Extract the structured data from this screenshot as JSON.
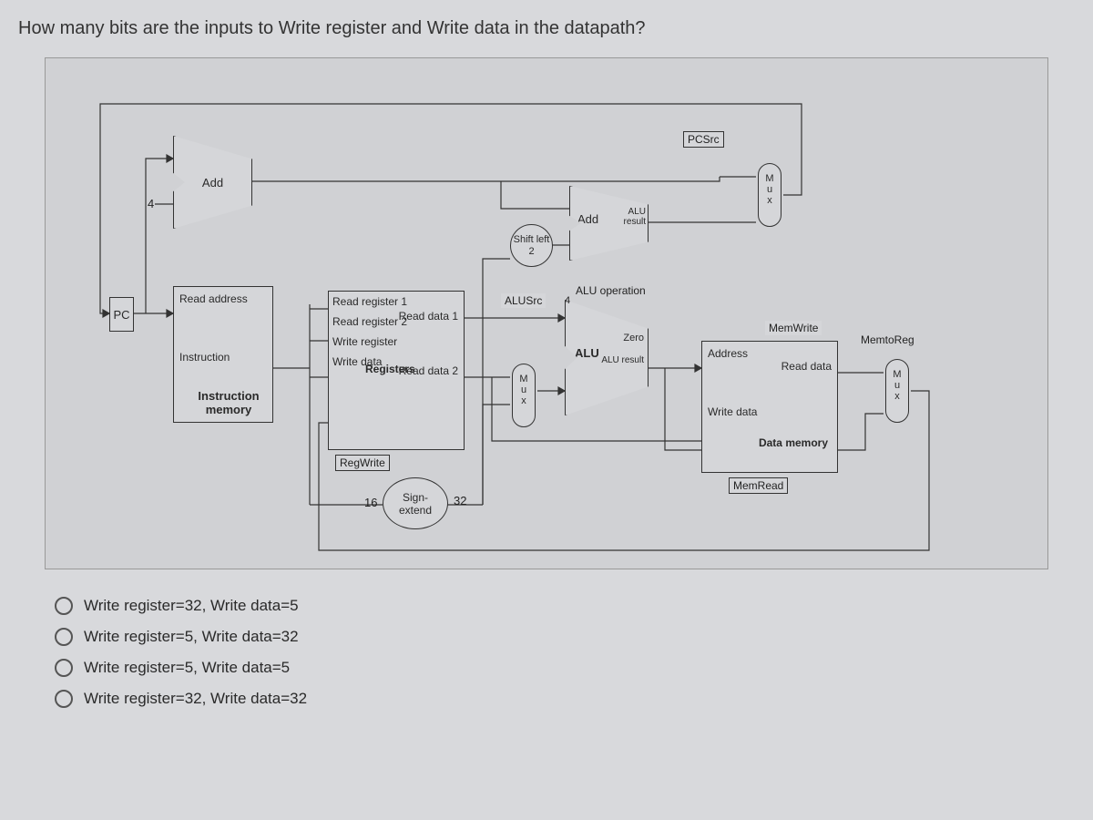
{
  "question": "How many bits are the inputs to Write register and Write data in the datapath?",
  "diagram": {
    "pc": "PC",
    "instr_mem_title": "Instruction memory",
    "instr_mem_port1": "Read address",
    "instr_mem_port2": "Instruction",
    "add1": "Add",
    "const4": "4",
    "regfile_title": "Registers",
    "regfile_rr1": "Read register 1",
    "regfile_rr2": "Read register 2",
    "regfile_wr": "Write register",
    "regfile_wd": "Write data",
    "regfile_rd1": "Read data 1",
    "regfile_rd2": "Read data 2",
    "regwrite": "RegWrite",
    "sign_ext": "Sign-\nextend",
    "se_in": "16",
    "se_out": "32",
    "shift": "Shift\nleft 2",
    "alusrc": "ALUSrc",
    "mux": "M\nu\nx",
    "alu": "ALU",
    "alu_zero": "Zero",
    "alu_result": "ALU result",
    "aluop": "ALU operation",
    "aluop_bits": "4",
    "add2": "Add",
    "add2_result": "ALU result",
    "pcsrc": "PCSrc",
    "dmem_title": "Data memory",
    "dmem_addr": "Address",
    "dmem_rd": "Read data",
    "dmem_wd": "Write data",
    "memwrite": "MemWrite",
    "memread": "MemRead",
    "memtoreg": "MemtoReg"
  },
  "options": [
    "Write register=32, Write data=5",
    "Write register=5, Write data=32",
    "Write register=5, Write data=5",
    "Write register=32, Write data=32"
  ]
}
